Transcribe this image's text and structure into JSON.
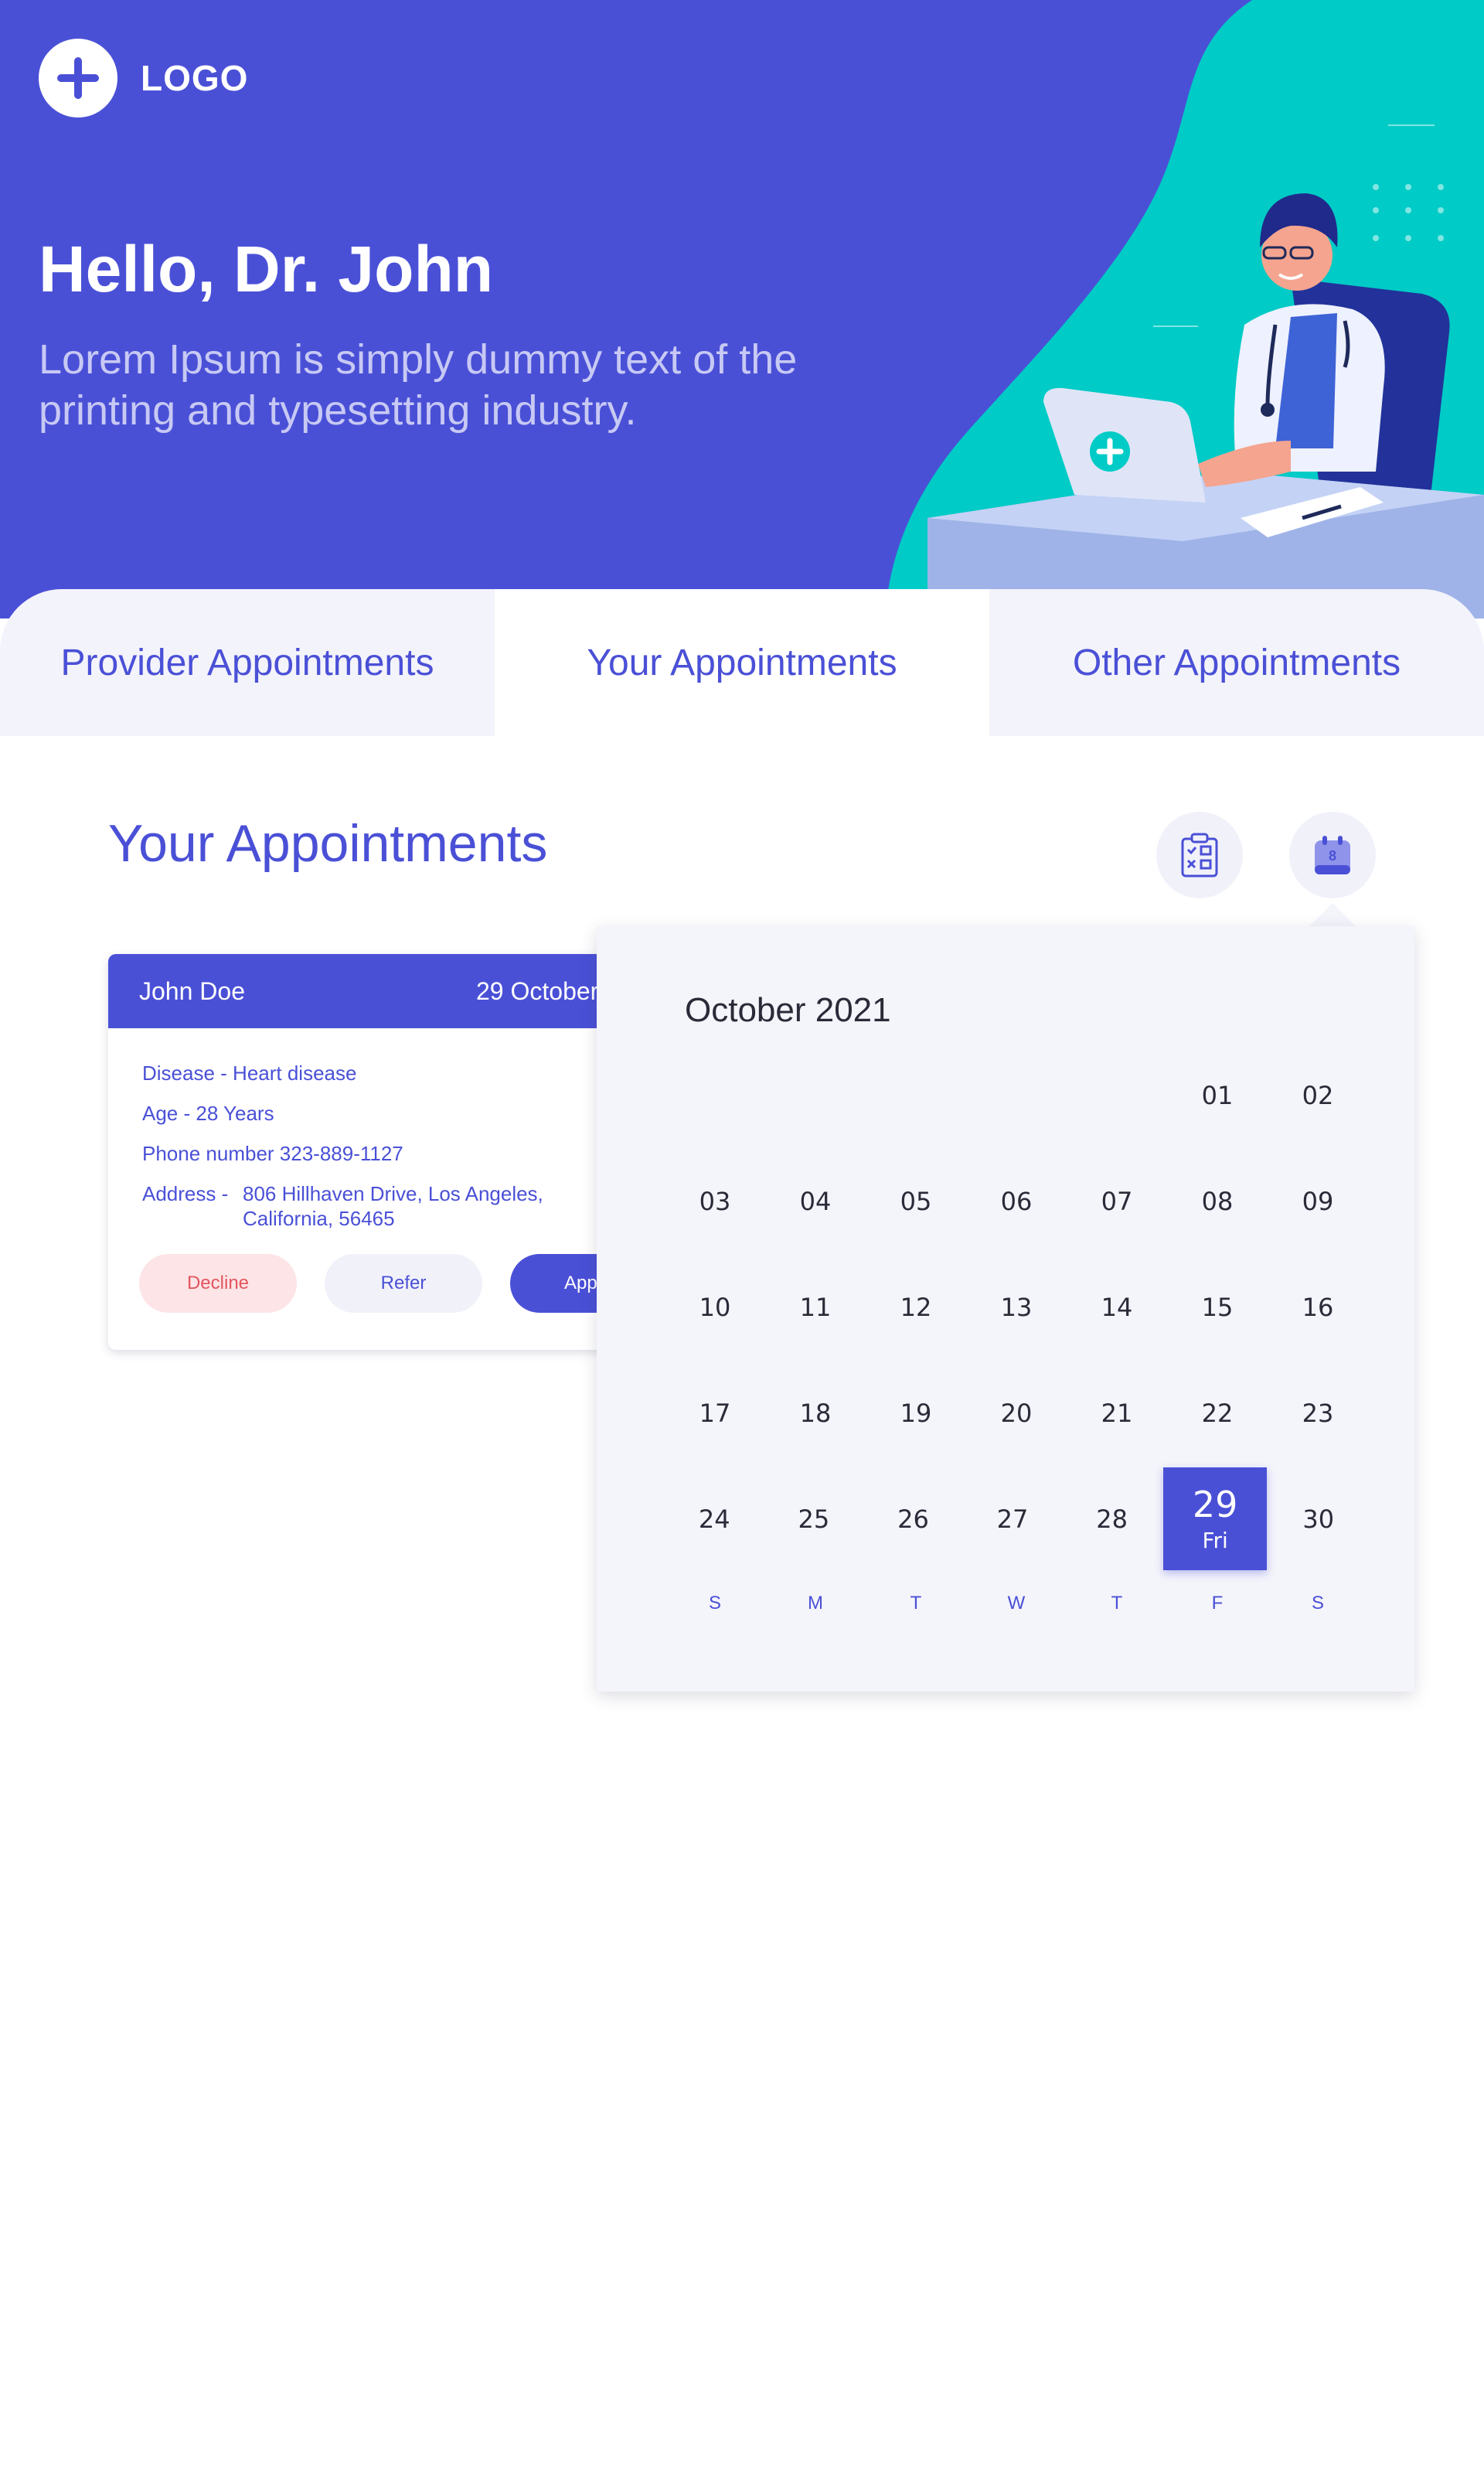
{
  "logo": {
    "text": "LOGO"
  },
  "hero": {
    "title": "Hello, Dr. John",
    "subtitle": "Lorem Ipsum is simply dummy text of the printing and typesetting industry."
  },
  "tabs": [
    {
      "label": "Provider Appointments"
    },
    {
      "label": "Your Appointments"
    },
    {
      "label": "Other Appointments"
    }
  ],
  "section": {
    "title": "Your Appointments"
  },
  "calendar_button_badge": "8",
  "appointment": {
    "name": "John Doe",
    "date": "29 October",
    "disease": "Disease - Heart disease",
    "age": "Age - 28 Years",
    "phone": "Phone number  323-889-1127",
    "address_label": "Address -",
    "address_line1": "806 Hillhaven Drive, Los Angeles,",
    "address_line2": "California, 56465",
    "decline": "Decline",
    "refer": "Refer",
    "approve": "Appro"
  },
  "calendar": {
    "title": "October 2021",
    "weeks": [
      [
        "",
        "",
        "",
        "",
        "",
        "01",
        "02"
      ],
      [
        "03",
        "04",
        "05",
        "06",
        "07",
        "08",
        "09"
      ],
      [
        "10",
        "11",
        "12",
        "13",
        "14",
        "15",
        "16"
      ],
      [
        "17",
        "18",
        "19",
        "20",
        "21",
        "22",
        "23"
      ],
      [
        "24",
        "25",
        "26",
        "27",
        "28",
        "29",
        "30"
      ]
    ],
    "selected": {
      "day": "29",
      "weekday": "Fri"
    },
    "weekdays": [
      "S",
      "M",
      "T",
      "W",
      "T",
      "F",
      "S"
    ]
  },
  "colors": {
    "primary": "#4a50d6",
    "teal": "#00cbc6",
    "decline_bg": "#fde4e6",
    "decline_text": "#e2555e"
  }
}
